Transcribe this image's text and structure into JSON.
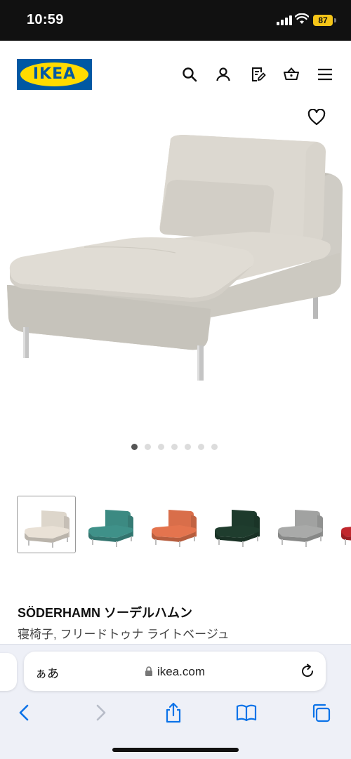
{
  "status": {
    "time": "10:59",
    "battery": "87"
  },
  "header": {
    "logo_text": "IKEA"
  },
  "product": {
    "name": "SÖDERHAMN ソーデルハムン",
    "description": "寝椅子, フリードトゥナ ライトベージュ"
  },
  "gallery": {
    "page_count": 7,
    "active_index": 0
  },
  "thumbnails": [
    {
      "color": "#e9e1d6"
    },
    {
      "color": "#3f9189"
    },
    {
      "color": "#e4744e"
    },
    {
      "color": "#1f3d2e"
    },
    {
      "color": "#a9aaa9"
    },
    {
      "color": "#c1272d"
    }
  ],
  "browser": {
    "text_size_label": "ぁあ",
    "url": "ikea.com"
  }
}
